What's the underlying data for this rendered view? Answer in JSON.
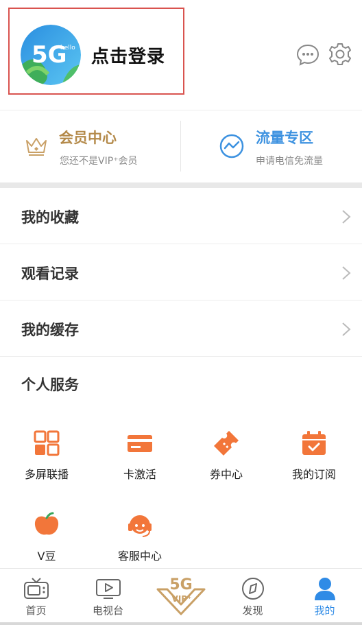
{
  "header": {
    "login_text": "点击登录",
    "avatar_badge": "5G",
    "avatar_small": "hello"
  },
  "member": {
    "title": "会员中心",
    "subtitle": "您还不是VIP⁺会员"
  },
  "traffic": {
    "title": "流量专区",
    "subtitle": "申请电信免流量"
  },
  "list": [
    {
      "label": "我的收藏"
    },
    {
      "label": "观看记录"
    },
    {
      "label": "我的缓存"
    }
  ],
  "services": {
    "title": "个人服务",
    "items": [
      {
        "label": "多屏联播",
        "icon": "grid-icon"
      },
      {
        "label": "卡激活",
        "icon": "card-icon"
      },
      {
        "label": "券中心",
        "icon": "ticket-icon"
      },
      {
        "label": "我的订阅",
        "icon": "calendar-check-icon"
      },
      {
        "label": "V豆",
        "icon": "bean-icon"
      },
      {
        "label": "客服中心",
        "icon": "headset-icon"
      }
    ]
  },
  "tabbar": {
    "items": [
      {
        "label": "首页",
        "icon": "tv-icon",
        "active": false
      },
      {
        "label": "电视台",
        "icon": "play-screen-icon",
        "active": false
      },
      {
        "label": "5G VIP+",
        "icon": "vip-badge-icon",
        "active": false
      },
      {
        "label": "发现",
        "icon": "compass-icon",
        "active": false
      },
      {
        "label": "我的",
        "icon": "user-icon",
        "active": true
      }
    ],
    "vip_top": "5G",
    "vip_bottom": "VIP⁺"
  },
  "colors": {
    "accent_blue": "#2f8be6",
    "gold": "#b48a4a",
    "orange": "#f2763a",
    "highlight_border": "#d9534f"
  }
}
